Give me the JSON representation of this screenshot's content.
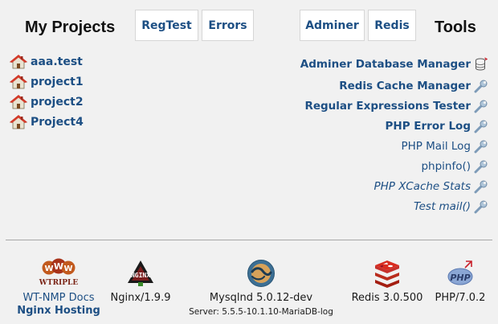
{
  "header": {
    "projects_title": "My Projects",
    "tools_title": "Tools",
    "tabs": [
      {
        "label": "RegTest"
      },
      {
        "label": "Errors"
      },
      {
        "label": "Adminer"
      },
      {
        "label": "Redis"
      }
    ]
  },
  "projects": [
    {
      "name": "aaa.test"
    },
    {
      "name": "project1"
    },
    {
      "name": "project2"
    },
    {
      "name": "Project4"
    }
  ],
  "tools": [
    {
      "label": "Adminer Database Manager",
      "icon": "database-icon"
    },
    {
      "label": "Redis Cache Manager",
      "icon": "wrench-icon"
    },
    {
      "label": "Regular Expressions Tester",
      "icon": "wrench-icon"
    },
    {
      "label": "PHP Error Log",
      "icon": "wrench-icon"
    },
    {
      "label": "PHP Mail Log",
      "icon": "wrench-icon"
    },
    {
      "label": "phpinfo()",
      "icon": "wrench-icon"
    },
    {
      "label": "PHP XCache Stats",
      "icon": "wrench-icon"
    },
    {
      "label": "Test mail()",
      "icon": "wrench-icon"
    }
  ],
  "footer": {
    "wtriple": {
      "logo_text": "WTRIPLE",
      "docs": "WT-NMP Docs",
      "hosting": "Nginx Hosting"
    },
    "nginx": {
      "logo_text": "NGINX",
      "version": "Nginx/1.9.9"
    },
    "mysql": {
      "version": "Mysqlnd 5.0.12-dev",
      "server": "Server: 5.5.5-10.1.10-MariaDB-log"
    },
    "redis": {
      "version": "Redis 3.0.500"
    },
    "php": {
      "logo_text": "PHP",
      "version": "PHP/7.0.2"
    }
  },
  "colors": {
    "link": "#1d4f84",
    "background": "#f1f1f1",
    "tab_background": "#ffffff"
  }
}
